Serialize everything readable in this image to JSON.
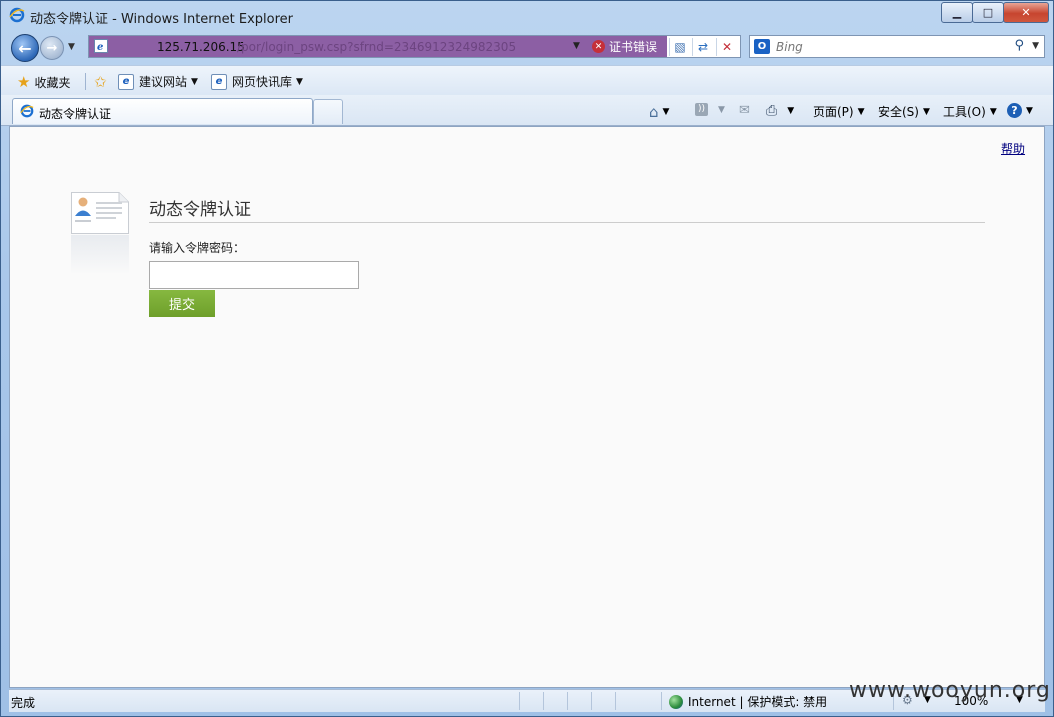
{
  "window": {
    "title": "动态令牌认证 - Windows Internet Explorer",
    "controls": {
      "minimize": "▁",
      "maximize": "□",
      "close": "✕"
    }
  },
  "nav": {
    "address_host": "125.71.206.15",
    "address_path": "/por/login_psw.csp?sfrnd=2346912324982305",
    "cert_error": "证书错误",
    "search_placeholder": "Bing",
    "search_logo": "O"
  },
  "favorites": {
    "favorites_label": "收藏夹",
    "suggested_sites": "建议网站",
    "web_slice_gallery": "网页快讯库"
  },
  "tab": {
    "title": "动态令牌认证"
  },
  "commands": {
    "page": "页面(P)",
    "safety": "安全(S)",
    "tools": "工具(O)"
  },
  "page": {
    "help_link": "帮助",
    "heading": "动态令牌认证",
    "field_label": "请输入令牌密码：",
    "token_value": "",
    "submit_label": "提交"
  },
  "status": {
    "left_text": "完成",
    "zone": "Internet | 保护模式: 禁用",
    "zoom": "100%"
  },
  "watermark": "www.wooyun.org"
}
